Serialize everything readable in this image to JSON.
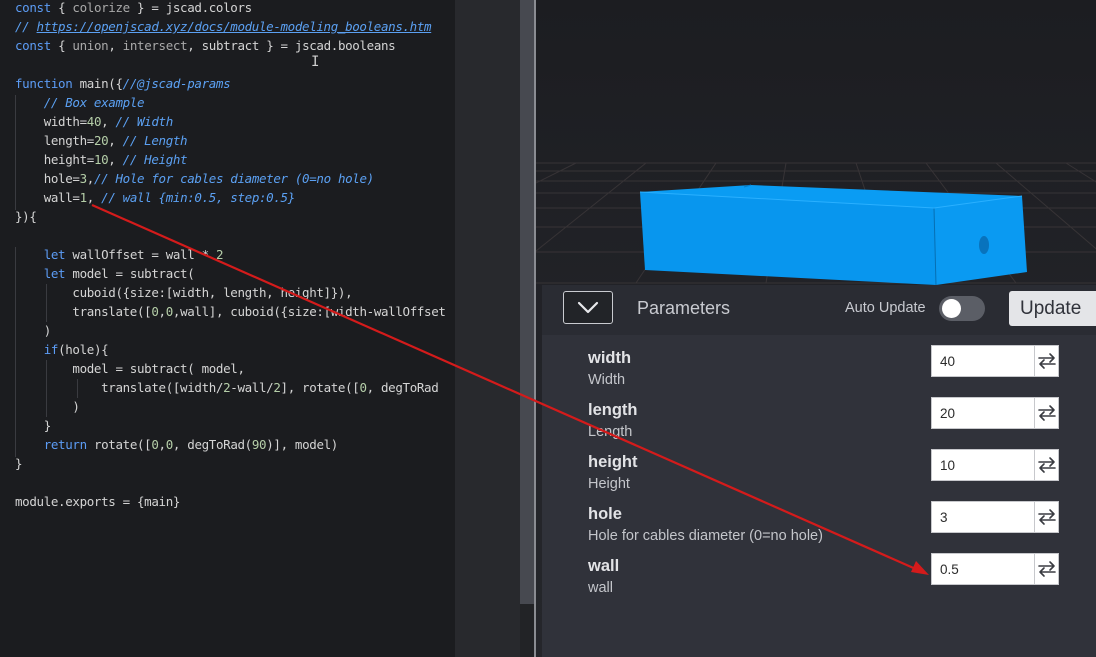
{
  "editor": {
    "lines": [
      [
        {
          "t": "const",
          "c": "kw"
        },
        {
          "t": " { "
        },
        {
          "t": "colorize",
          "c": "dim"
        },
        {
          "t": " } = jscad.colors"
        }
      ],
      [
        {
          "t": "// ",
          "c": "cm"
        },
        {
          "t": "https://openjscad.xyz/docs/module-modeling_booleans.htm",
          "c": "url"
        }
      ],
      [
        {
          "t": "const",
          "c": "kw"
        },
        {
          "t": " { "
        },
        {
          "t": "union",
          "c": "dim"
        },
        {
          "t": ", "
        },
        {
          "t": "intersect",
          "c": "dim"
        },
        {
          "t": ", subtract } = jscad.booleans"
        }
      ],
      [],
      [
        {
          "t": "function",
          "c": "kw"
        },
        {
          "t": " main({"
        },
        {
          "t": "//@jscad-params",
          "c": "cm"
        }
      ],
      [
        {
          "t": "    "
        },
        {
          "t": "// Box example",
          "c": "cm"
        }
      ],
      [
        {
          "t": "    width="
        },
        {
          "t": "40",
          "c": "num"
        },
        {
          "t": ", "
        },
        {
          "t": "// Width",
          "c": "cm"
        }
      ],
      [
        {
          "t": "    length="
        },
        {
          "t": "20",
          "c": "num"
        },
        {
          "t": ", "
        },
        {
          "t": "// Length",
          "c": "cm"
        }
      ],
      [
        {
          "t": "    height="
        },
        {
          "t": "10",
          "c": "num"
        },
        {
          "t": ", "
        },
        {
          "t": "// Height",
          "c": "cm"
        }
      ],
      [
        {
          "t": "    hole="
        },
        {
          "t": "3",
          "c": "num"
        },
        {
          "t": ","
        },
        {
          "t": "// Hole for cables diameter (0=no hole)",
          "c": "cm"
        }
      ],
      [
        {
          "t": "    wall="
        },
        {
          "t": "1",
          "c": "num"
        },
        {
          "t": ", "
        },
        {
          "t": "// wall {min:0.5, step:0.5}",
          "c": "cm"
        }
      ],
      [
        {
          "t": "}){"
        }
      ],
      [],
      [
        {
          "t": "    "
        },
        {
          "t": "let",
          "c": "kw"
        },
        {
          "t": " wallOffset = wall * "
        },
        {
          "t": "2",
          "c": "num"
        }
      ],
      [
        {
          "t": "    "
        },
        {
          "t": "let",
          "c": "kw"
        },
        {
          "t": " model = subtract("
        }
      ],
      [
        {
          "t": "        cuboid({size:[width, length, height]}),"
        }
      ],
      [
        {
          "t": "        translate(["
        },
        {
          "t": "0",
          "c": "num"
        },
        {
          "t": ","
        },
        {
          "t": "0",
          "c": "num"
        },
        {
          "t": ",wall], cuboid({size:[width-wallOffset"
        }
      ],
      [
        {
          "t": "    )"
        }
      ],
      [
        {
          "t": "    "
        },
        {
          "t": "if",
          "c": "kw"
        },
        {
          "t": "(hole){"
        }
      ],
      [
        {
          "t": "        model = subtract( model,"
        }
      ],
      [
        {
          "t": "            translate([width/"
        },
        {
          "t": "2",
          "c": "num"
        },
        {
          "t": "-wall/"
        },
        {
          "t": "2",
          "c": "num"
        },
        {
          "t": "], rotate(["
        },
        {
          "t": "0",
          "c": "num"
        },
        {
          "t": ", degToRad"
        }
      ],
      [
        {
          "t": "        )"
        }
      ],
      [
        {
          "t": "    }"
        }
      ],
      [
        {
          "t": "    "
        },
        {
          "t": "return",
          "c": "kw"
        },
        {
          "t": " rotate(["
        },
        {
          "t": "0",
          "c": "num"
        },
        {
          "t": ","
        },
        {
          "t": "0",
          "c": "num"
        },
        {
          "t": ", degToRad("
        },
        {
          "t": "90",
          "c": "num"
        },
        {
          "t": ")], model)"
        }
      ],
      [
        {
          "t": "}"
        }
      ],
      [],
      [
        {
          "t": "module.exports = {main}"
        }
      ]
    ]
  },
  "viewer": {
    "model_color": "#0a9cf3"
  },
  "params_panel": {
    "title": "Parameters",
    "auto_update_label": "Auto Update",
    "auto_update_on": false,
    "update_button": "Update",
    "collapse_icon": "chevron-down-icon",
    "swap_icon": "swap-arrows-icon",
    "rows": [
      {
        "name": "width",
        "caption": "Width",
        "value": "40"
      },
      {
        "name": "length",
        "caption": "Length",
        "value": "20"
      },
      {
        "name": "height",
        "caption": "Height",
        "value": "10"
      },
      {
        "name": "hole",
        "caption": "Hole for cables diameter (0=no hole)",
        "value": "3"
      },
      {
        "name": "wall",
        "caption": "wall",
        "value": "0.5"
      }
    ]
  },
  "annotation": {
    "color": "#d41b1b"
  }
}
